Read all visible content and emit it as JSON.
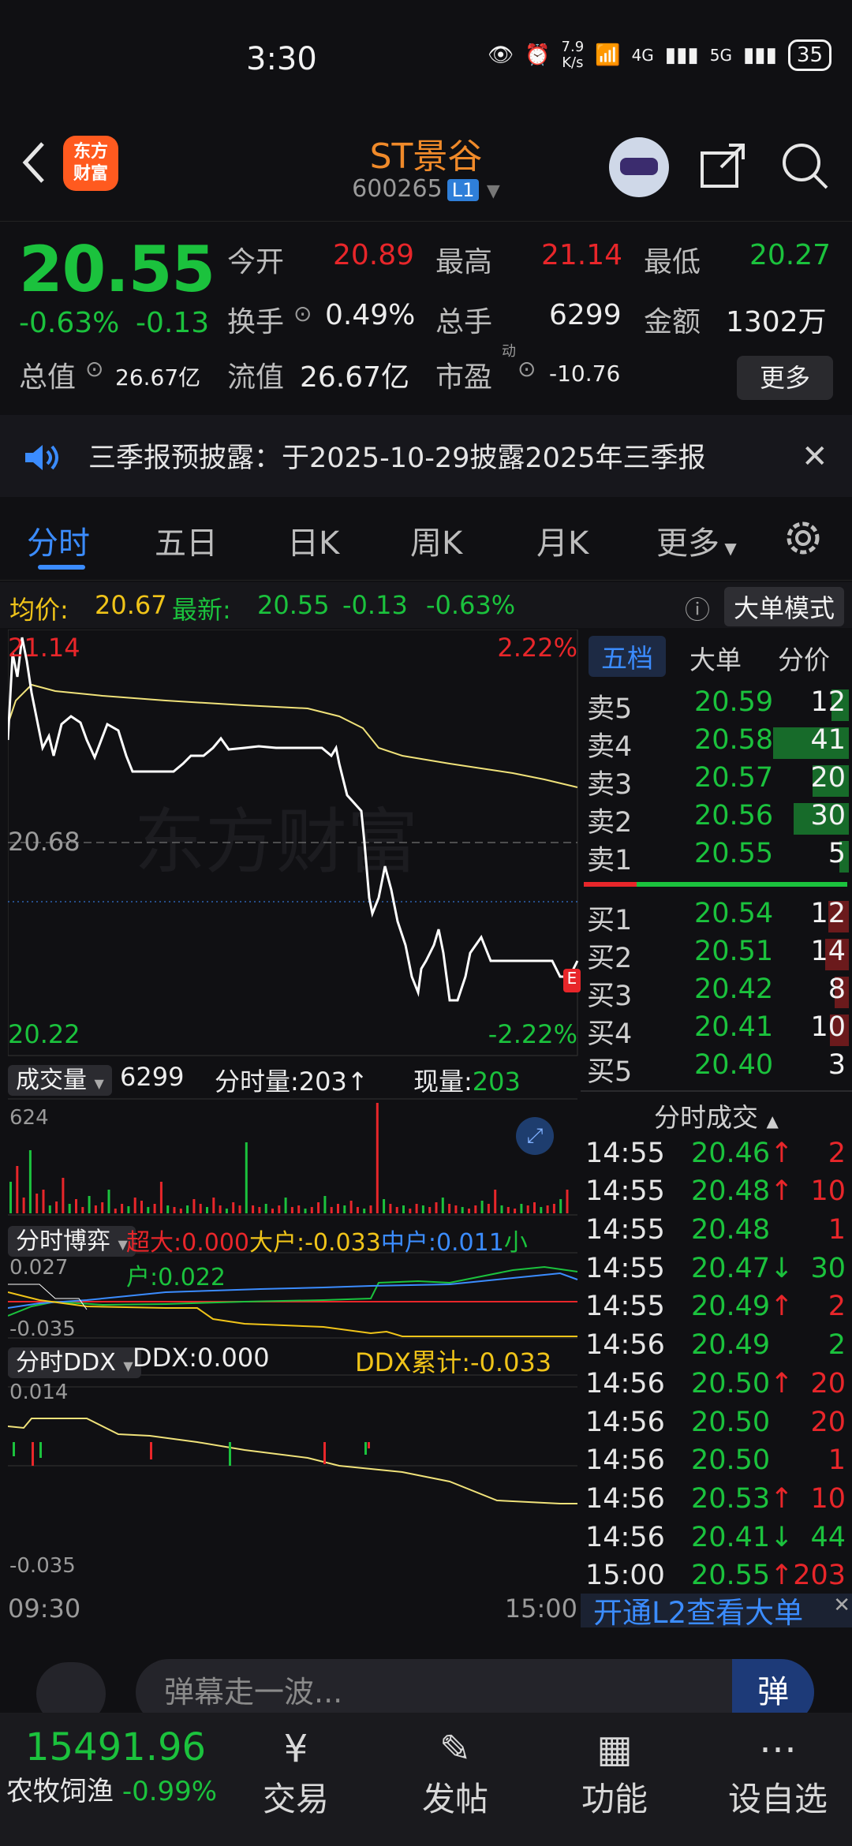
{
  "status": {
    "time": "3:30",
    "net_speed_top": "7.9",
    "net_speed_bottom": "K/s",
    "signal1": "4G",
    "signal2": "5G",
    "battery": "35"
  },
  "header": {
    "logo_line1": "东方",
    "logo_line2": "财富",
    "stock_name": "ST景谷",
    "stock_code": "600265",
    "level_badge": "L1"
  },
  "quote": {
    "last_price": "20.55",
    "change_pct": "-0.63%",
    "change_amt": "-0.13",
    "open_label": "今开",
    "open": "20.89",
    "high_label": "最高",
    "high": "21.14",
    "low_label": "最低",
    "low": "20.27",
    "turnover_label": "换手",
    "turnover": "0.49%",
    "volume_label": "总手",
    "volume": "6299",
    "amount_label": "金额",
    "amount": "1302万",
    "total_mv_label": "总值",
    "total_mv": "26.67亿",
    "float_mv_label": "流值",
    "float_mv": "26.67亿",
    "pe_label": "市盈",
    "pe_sup": "动",
    "pe": "-10.76",
    "more_label": "更多"
  },
  "notice": {
    "text": "三季报预披露：于2025-10-29披露2025年三季报"
  },
  "tabs": [
    "分时",
    "五日",
    "日K",
    "周K",
    "月K",
    "更多"
  ],
  "avg_bar": {
    "avg_label": "均价:",
    "avg": "20.67",
    "latest_label": "最新:",
    "latest": "20.55",
    "chg": "-0.13",
    "pct": "-0.63%",
    "mode_button": "大单模式"
  },
  "main_chart": {
    "top_price": "21.14",
    "top_pct": "2.22%",
    "mid_price": "20.68",
    "bottom_price": "20.22",
    "bottom_pct": "-2.22%",
    "watermark": "东方财富"
  },
  "volume_panel": {
    "dropdown": "成交量",
    "total": "6299",
    "tick_label": "分时量:",
    "tick_val": "203",
    "now_label": "现量:",
    "now_val": "203",
    "max": "624"
  },
  "game_panel": {
    "dropdown": "分时博弈",
    "super_label": "超大:",
    "super_val": "0.000",
    "big_label": "大户:",
    "big_val": "-0.033",
    "mid_label": "中户:",
    "mid_val": "0.011",
    "small_label": "小户:",
    "small_val": "0.022",
    "top": "0.027",
    "bottom": "-0.035"
  },
  "ddx_panel": {
    "dropdown": "分时DDX",
    "ddx_label": "DDX:",
    "ddx_val": "0.000",
    "ddx_cum_label": "DDX累计:",
    "ddx_cum_val": "-0.033",
    "top": "0.014",
    "bottom": "-0.035"
  },
  "time_axis": {
    "start": "09:30",
    "end": "15:00"
  },
  "order_book": {
    "tabs": [
      "五档",
      "大单",
      "分价"
    ],
    "asks": [
      {
        "label": "卖5",
        "price": "20.59",
        "qty": "12"
      },
      {
        "label": "卖4",
        "price": "20.58",
        "qty": "41"
      },
      {
        "label": "卖3",
        "price": "20.57",
        "qty": "20"
      },
      {
        "label": "卖2",
        "price": "20.56",
        "qty": "30"
      },
      {
        "label": "卖1",
        "price": "20.55",
        "qty": "5"
      }
    ],
    "bids": [
      {
        "label": "买1",
        "price": "20.54",
        "qty": "12"
      },
      {
        "label": "买2",
        "price": "20.51",
        "qty": "14"
      },
      {
        "label": "买3",
        "price": "20.42",
        "qty": "8"
      },
      {
        "label": "买4",
        "price": "20.41",
        "qty": "10"
      },
      {
        "label": "买5",
        "price": "20.40",
        "qty": "3"
      }
    ]
  },
  "trades": {
    "title": "分时成交",
    "rows": [
      {
        "time": "14:55",
        "price": "20.46",
        "dir": "↑",
        "vol": "2"
      },
      {
        "time": "14:55",
        "price": "20.48",
        "dir": "↑",
        "vol": "10"
      },
      {
        "time": "14:55",
        "price": "20.48",
        "dir": "",
        "vol": "1"
      },
      {
        "time": "14:55",
        "price": "20.47",
        "dir": "↓",
        "vol": "30"
      },
      {
        "time": "14:55",
        "price": "20.49",
        "dir": "↑",
        "vol": "2"
      },
      {
        "time": "14:56",
        "price": "20.49",
        "dir": "",
        "vol": "2"
      },
      {
        "time": "14:56",
        "price": "20.50",
        "dir": "↑",
        "vol": "20"
      },
      {
        "time": "14:56",
        "price": "20.50",
        "dir": "",
        "vol": "20"
      },
      {
        "time": "14:56",
        "price": "20.50",
        "dir": "",
        "vol": "1"
      },
      {
        "time": "14:56",
        "price": "20.53",
        "dir": "↑",
        "vol": "10"
      },
      {
        "time": "14:56",
        "price": "20.41",
        "dir": "↓",
        "vol": "44"
      },
      {
        "time": "15:00",
        "price": "20.55",
        "dir": "↑",
        "vol": "203"
      }
    ],
    "l2_promo": "开通L2查看大单"
  },
  "bottom": {
    "danmu_placeholder": "弹幕走一波...",
    "danmu_button": "弹",
    "index_value": "15491.96",
    "index_name": "农牧饲渔",
    "index_pct": "-0.99%",
    "nav": [
      "交易",
      "发帖",
      "功能",
      "设自选"
    ]
  },
  "colors": {
    "up": "#e8262a",
    "down": "#1bc23d",
    "accent": "#3b8cff",
    "brand": "#f08a2a",
    "avg_line": "#f0e27a"
  }
}
